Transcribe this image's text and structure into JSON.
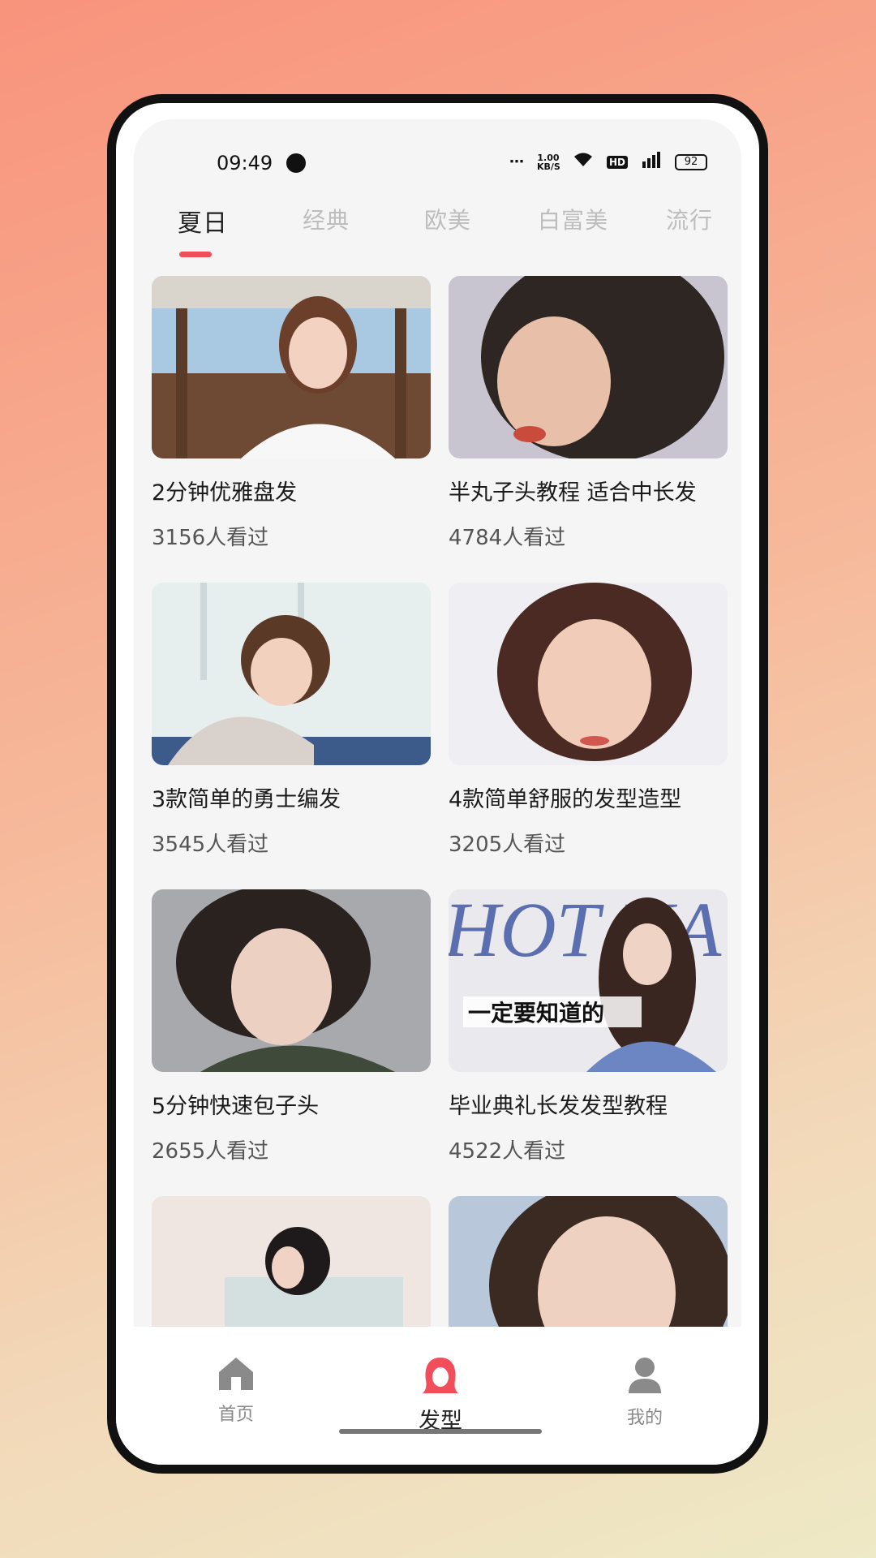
{
  "status_bar": {
    "time": "09:49",
    "network_speed": "1.00 KB/S",
    "hd_label": "HD",
    "battery": "92"
  },
  "tabs": [
    {
      "label": "夏日",
      "active": true
    },
    {
      "label": "经典",
      "active": false
    },
    {
      "label": "欧美",
      "active": false
    },
    {
      "label": "白富美",
      "active": false
    },
    {
      "label": "流行",
      "active": false
    }
  ],
  "cards": [
    {
      "title": "2分钟优雅盘发",
      "views": "3156人看过"
    },
    {
      "title": "半丸子头教程 适合中长发",
      "views": "4784人看过"
    },
    {
      "title": "3款简单的勇士编发",
      "views": "3545人看过"
    },
    {
      "title": "4款简单舒服的发型造型",
      "views": "3205人看过"
    },
    {
      "title": "5分钟快速包子头",
      "views": "2655人看过"
    },
    {
      "title": "毕业典礼长发发型教程",
      "views": "4522人看过"
    },
    {
      "title": "",
      "views": ""
    },
    {
      "title": "",
      "views": ""
    }
  ],
  "thumb_overlay": {
    "hot_text": "HOT HA",
    "caption": "一定要知道的"
  },
  "bottom_nav": [
    {
      "label": "首页",
      "icon": "home-icon",
      "active": false
    },
    {
      "label": "发型",
      "icon": "hairstyle-icon",
      "active": true
    },
    {
      "label": "我的",
      "icon": "profile-icon",
      "active": false
    }
  ],
  "colors": {
    "accent": "#f24d5a",
    "tab_inactive": "#bdbdbd"
  }
}
